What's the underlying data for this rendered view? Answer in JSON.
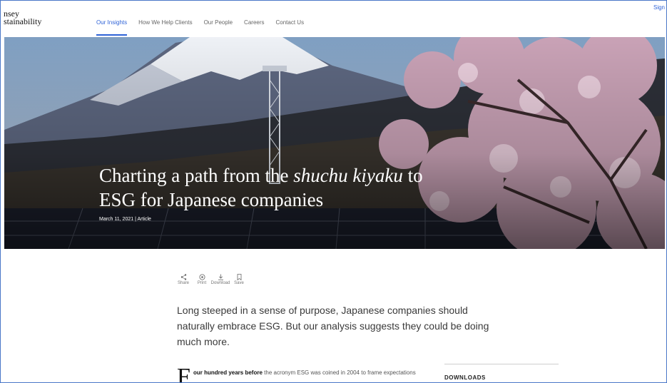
{
  "header": {
    "logo_line1": "nsey",
    "logo_line2": "stainability",
    "signin": "Sign",
    "nav": [
      "Our Insights",
      "How We Help Clients",
      "Our People",
      "Careers",
      "Contact Us"
    ],
    "active_nav": "Our Insights"
  },
  "hero": {
    "title_part1": "Charting a path from the ",
    "title_italic": "shuchu kiyaku",
    "title_part2": " to",
    "title_line2": "ESG for Japanese companies",
    "meta": "March 11, 2021 | Article"
  },
  "actions": [
    {
      "label": "Share",
      "icon": "share-icon"
    },
    {
      "label": "Print",
      "icon": "print-icon"
    },
    {
      "label": "Download",
      "icon": "download-icon"
    },
    {
      "label": "Save",
      "icon": "bookmark-icon"
    }
  ],
  "article": {
    "lead": "Long steeped in a sense of purpose, Japanese companies should naturally embrace ESG. But our analysis suggests they could be doing much more.",
    "dropcap": "F",
    "bold_start": "our hundred years before",
    "body": " the acronym ESG was coined in 2004 to frame expectations around a company's environmental, social, and corporate"
  },
  "sidebar": {
    "downloads_label": "DOWNLOADS"
  },
  "colors": {
    "accent": "#2f63d7",
    "frame_border": "#4a78c8"
  }
}
